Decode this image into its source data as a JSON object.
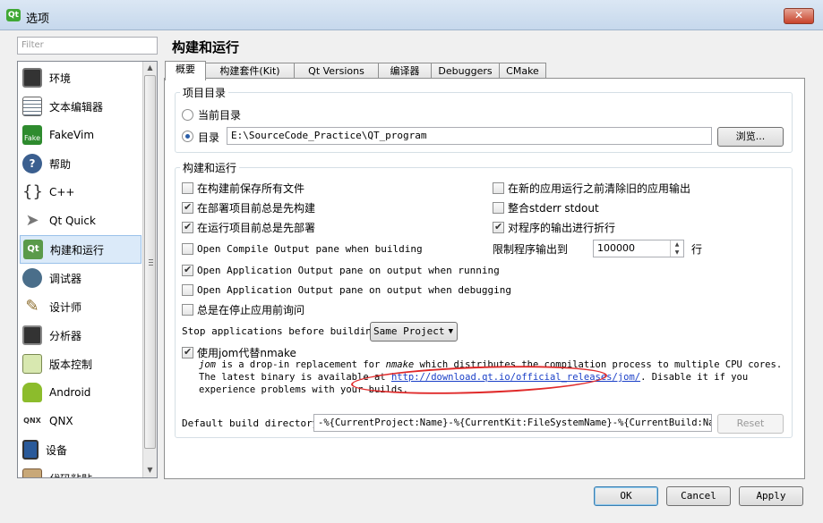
{
  "window": {
    "title": "选项",
    "app_icon": "qt-logo-icon"
  },
  "filter": {
    "placeholder": "Filter"
  },
  "sidebar": {
    "items": [
      {
        "label": "环境",
        "icon": "monitor-icon"
      },
      {
        "label": "文本编辑器",
        "icon": "text-editor-icon"
      },
      {
        "label": "FakeVim",
        "icon": "fakevim-icon"
      },
      {
        "label": "帮助",
        "icon": "help-icon"
      },
      {
        "label": "C++",
        "icon": "cpp-braces-icon"
      },
      {
        "label": "Qt Quick",
        "icon": "qt-quick-icon"
      },
      {
        "label": "构建和运行",
        "icon": "build-run-icon",
        "selected": true
      },
      {
        "label": "调试器",
        "icon": "debugger-icon"
      },
      {
        "label": "设计师",
        "icon": "designer-icon"
      },
      {
        "label": "分析器",
        "icon": "analyzer-icon"
      },
      {
        "label": "版本控制",
        "icon": "version-control-icon"
      },
      {
        "label": "Android",
        "icon": "android-icon"
      },
      {
        "label": "QNX",
        "icon": "qnx-icon"
      },
      {
        "label": "设备",
        "icon": "device-icon"
      },
      {
        "label": "代码粘贴",
        "icon": "code-paste-icon"
      }
    ]
  },
  "page": {
    "title": "构建和运行"
  },
  "tabs": [
    "概要",
    "构建套件(Kit)",
    "Qt Versions",
    "编译器",
    "Debuggers",
    "CMake"
  ],
  "project_dir": {
    "title": "项目目录",
    "current_label": "当前目录",
    "dir_label": "目录",
    "dir_value": "E:\\SourceCode_Practice\\QT_program",
    "browse_label": "浏览..."
  },
  "build_run": {
    "title": "构建和运行",
    "left_options": [
      {
        "label": "在构建前保存所有文件",
        "checked": false
      },
      {
        "label": "在部署项目前总是先构建",
        "checked": true
      },
      {
        "label": "在运行项目前总是先部署",
        "checked": true
      },
      {
        "label": "Open Compile Output pane when building",
        "checked": false
      },
      {
        "label": "Open Application Output pane on output when running",
        "checked": true
      },
      {
        "label": "Open Application Output pane on output when debugging",
        "checked": false
      },
      {
        "label": "总是在停止应用前询问",
        "checked": false
      }
    ],
    "right_options": [
      {
        "label": "在新的应用运行之前清除旧的应用输出",
        "checked": false
      },
      {
        "label": "整合stderr stdout",
        "checked": false
      },
      {
        "label": "对程序的输出进行折行",
        "checked": true
      }
    ],
    "limit_label": "限制程序输出到",
    "limit_value": "100000",
    "limit_unit": "行",
    "stop_label": "Stop applications before building:",
    "stop_value": "Same Project",
    "jom_label": "使用jom代替nmake",
    "jom_checked": true,
    "jom_desc_1": "jom",
    "jom_desc_2": " is a drop-in replacement for ",
    "jom_desc_3": "nmake",
    "jom_desc_4": " which distributes the compilation process to multiple CPU cores. The latest binary is available at ",
    "jom_link": "http://download.qt.io/official_releases/jom/",
    "jom_desc_5": ". Disable it if you experience problems with your builds.",
    "default_dir_label": "Default build directory:",
    "default_dir_value": "-%{CurrentProject:Name}-%{CurrentKit:FileSystemName}-%{CurrentBuild:Name}",
    "reset_label": "Reset"
  },
  "footer": {
    "ok": "OK",
    "cancel": "Cancel",
    "apply": "Apply"
  },
  "colors": {
    "link": "#1a3fc7",
    "annotation_circle": "#e02a2a",
    "selection": "#dbeaf9"
  }
}
